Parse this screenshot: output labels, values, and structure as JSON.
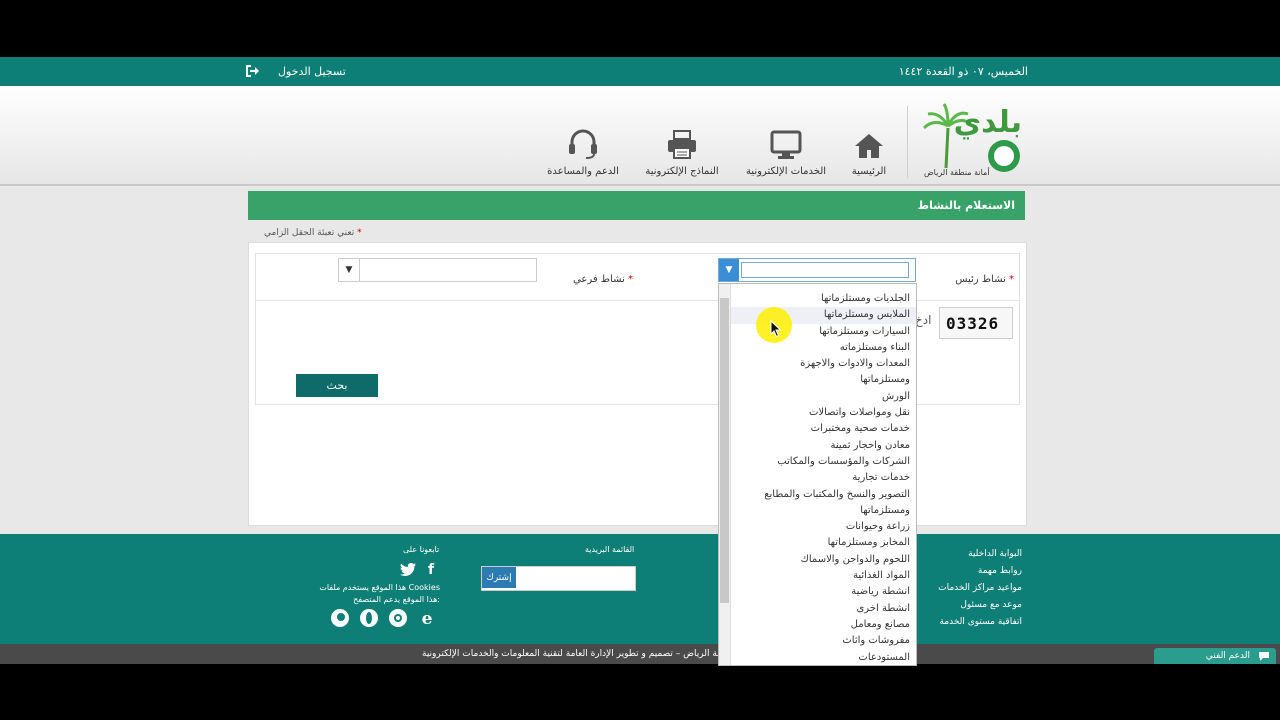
{
  "topbar": {
    "date": "الخميس، ٠٧ ذو القعدة ١٤٤٢",
    "login": "تسجيل الدخول"
  },
  "logo": {
    "brand": "بلدي",
    "subtitle": "أمانة منطقة الرياض"
  },
  "nav": [
    {
      "label": "الرئيسية",
      "icon": "home-icon"
    },
    {
      "label": "الخدمات الإلكترونية",
      "icon": "monitor-icon"
    },
    {
      "label": "النماذج الإلكترونية",
      "icon": "printer-icon"
    },
    {
      "label": "الدعم والمساعدة",
      "icon": "headset-icon"
    }
  ],
  "page": {
    "title": "الاستعلام بالنشاط",
    "required_note": "تعني تعبئة الحقل الزامي"
  },
  "form": {
    "main_activity_label": "نشاط رئيس",
    "sub_activity_label": "نشاط فرعي",
    "captcha_text": "03326",
    "captcha_prompt": "ادخ",
    "search_button": "بحث"
  },
  "dropdown_options": [
    "الجلديات ومستلزماتها",
    "الملابس ومستلزماتها",
    "السيارات ومستلزماتها",
    "البناء ومستلزماته",
    "المعدات والادوات والاجهزة",
    "ومستلزماتها",
    "الورش",
    "نقل ومواصلات واتصالات",
    "خدمات صحية ومختبرات",
    "معادن واحجار ثمينة",
    "الشركات والمؤسسات والمكاتب",
    "خدمات تجارية",
    "التصوير والنسخ والمكتبات والمطابع",
    "ومستلزماتها",
    "زراعة وحيوانات",
    "المخابز ومستلزماتها",
    "اللحوم والدواجن والاسماك",
    "المواد الغذائية",
    "انشطة رياضية",
    "انشطة اخرى",
    "مصانع ومعامل",
    "مفروشات واثاث",
    "المستودعات"
  ],
  "footer": {
    "links": [
      "البوابة الداخلية",
      "روابط مهمة",
      "مواعيد مراكز الخدمات",
      "موعد مع مسئول",
      "اتفاقية مستوى الخدمة"
    ],
    "mailing_title": "القائمة البريدية",
    "subscribe": "إشترك",
    "follow_title": "تابعونا على",
    "cookies": "هذا الموقع يستخدم ملفات Cookies",
    "browsers": "هذا الموقع يدعم المتصفح:",
    "copyright": "يقة الرياض – تصميم و تطوير الإدارة العامة لتقنية المعلومات والخدمات الإلكترونية",
    "support": "الدعم الفني"
  },
  "colors": {
    "teal": "#0e7f77",
    "green": "#38a269",
    "button": "#0e6b6a"
  }
}
